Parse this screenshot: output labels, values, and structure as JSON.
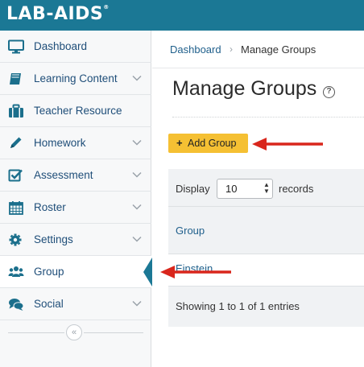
{
  "header": {
    "logo_text": "LAB-AIDS",
    "trademark": "®"
  },
  "sidebar": {
    "items": [
      {
        "label": "Dashboard",
        "icon": "monitor-icon",
        "has_chevron": false
      },
      {
        "label": "Learning Content",
        "icon": "book-icon",
        "has_chevron": true
      },
      {
        "label": "Teacher Resource",
        "icon": "briefcase-icon",
        "has_chevron": false
      },
      {
        "label": "Homework",
        "icon": "pencil-icon",
        "has_chevron": true
      },
      {
        "label": "Assessment",
        "icon": "checkbox-icon",
        "has_chevron": true
      },
      {
        "label": "Roster",
        "icon": "calendar-icon",
        "has_chevron": true
      },
      {
        "label": "Settings",
        "icon": "gear-icon",
        "has_chevron": true
      },
      {
        "label": "Group",
        "icon": "users-icon",
        "has_chevron": false,
        "active": true
      },
      {
        "label": "Social",
        "icon": "chat-icon",
        "has_chevron": true
      }
    ],
    "collapse_icon": "«"
  },
  "breadcrumb": {
    "home": "Dashboard",
    "separator": "›",
    "current": "Manage Groups"
  },
  "main": {
    "title": "Manage Groups",
    "help_icon": "?",
    "add_button": {
      "icon": "+",
      "label": "Add Group"
    }
  },
  "table": {
    "display_label": "Display",
    "page_length": "10",
    "records_label": "records",
    "column_header": "Group",
    "rows": [
      {
        "group": "Einstein"
      }
    ],
    "info": "Showing 1 to 1 of 1 entries"
  },
  "colors": {
    "brand": "#1b7895",
    "link": "#1f5f8b",
    "button": "#f5c033",
    "annotation_arrow": "#d9261c"
  }
}
